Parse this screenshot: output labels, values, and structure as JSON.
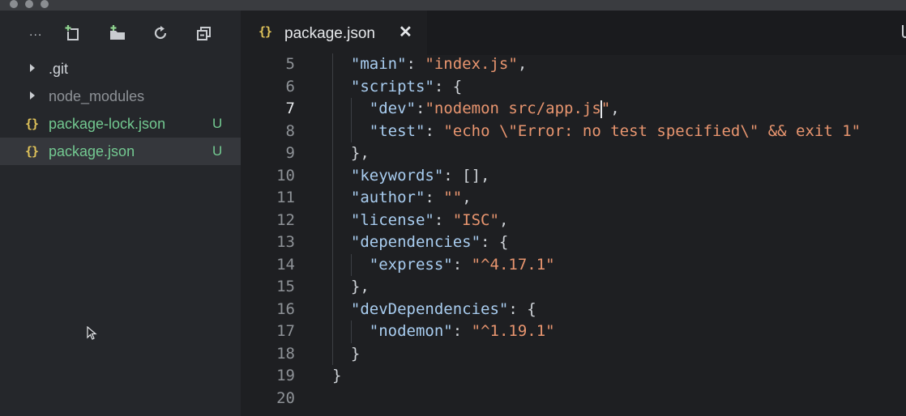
{
  "window": {
    "traffic_lights": [
      "close",
      "minimize",
      "zoom"
    ]
  },
  "sidebar": {
    "toolbar": {
      "more_label": "...",
      "buttons": [
        {
          "name": "new-file-icon"
        },
        {
          "name": "new-folder-icon"
        },
        {
          "name": "refresh-icon"
        },
        {
          "name": "collapse-all-icon"
        }
      ]
    },
    "items": [
      {
        "label": ".git",
        "type": "folder",
        "status": ""
      },
      {
        "label": "node_modules",
        "type": "folder",
        "status": ""
      },
      {
        "label": "package-lock.json",
        "type": "json-file",
        "status": "U"
      },
      {
        "label": "package.json",
        "type": "json-file",
        "status": "U",
        "selected": true
      }
    ]
  },
  "editor": {
    "tab": {
      "icon": "{}",
      "title": "package.json",
      "close": "✕"
    },
    "active_line": 7,
    "lines": [
      {
        "n": "5",
        "text": "\"main\": \"index.js\","
      },
      {
        "n": "6",
        "text": "\"scripts\": {"
      },
      {
        "n": "7",
        "text": "\"dev\":\"nodemon src/app.js\","
      },
      {
        "n": "8",
        "text": "\"test\": \"echo \\\"Error: no test specified\\\" && exit 1\""
      },
      {
        "n": "9",
        "text": "},"
      },
      {
        "n": "10",
        "text": "\"keywords\": [],"
      },
      {
        "n": "11",
        "text": "\"author\": \"\","
      },
      {
        "n": "12",
        "text": "\"license\": \"ISC\","
      },
      {
        "n": "13",
        "text": "\"dependencies\": {"
      },
      {
        "n": "14",
        "text": "\"express\": \"^4.17.1\""
      },
      {
        "n": "15",
        "text": "},"
      },
      {
        "n": "16",
        "text": "\"devDependencies\": {"
      },
      {
        "n": "17",
        "text": "\"nodemon\": \"^1.19.1\""
      },
      {
        "n": "18",
        "text": "}"
      },
      {
        "n": "19",
        "text": "}"
      },
      {
        "n": "20",
        "text": ""
      }
    ]
  },
  "colors": {
    "key": "#a9cdf0",
    "string": "#e8956f",
    "untracked": "#73c991",
    "json_icon": "#e1c45a"
  }
}
